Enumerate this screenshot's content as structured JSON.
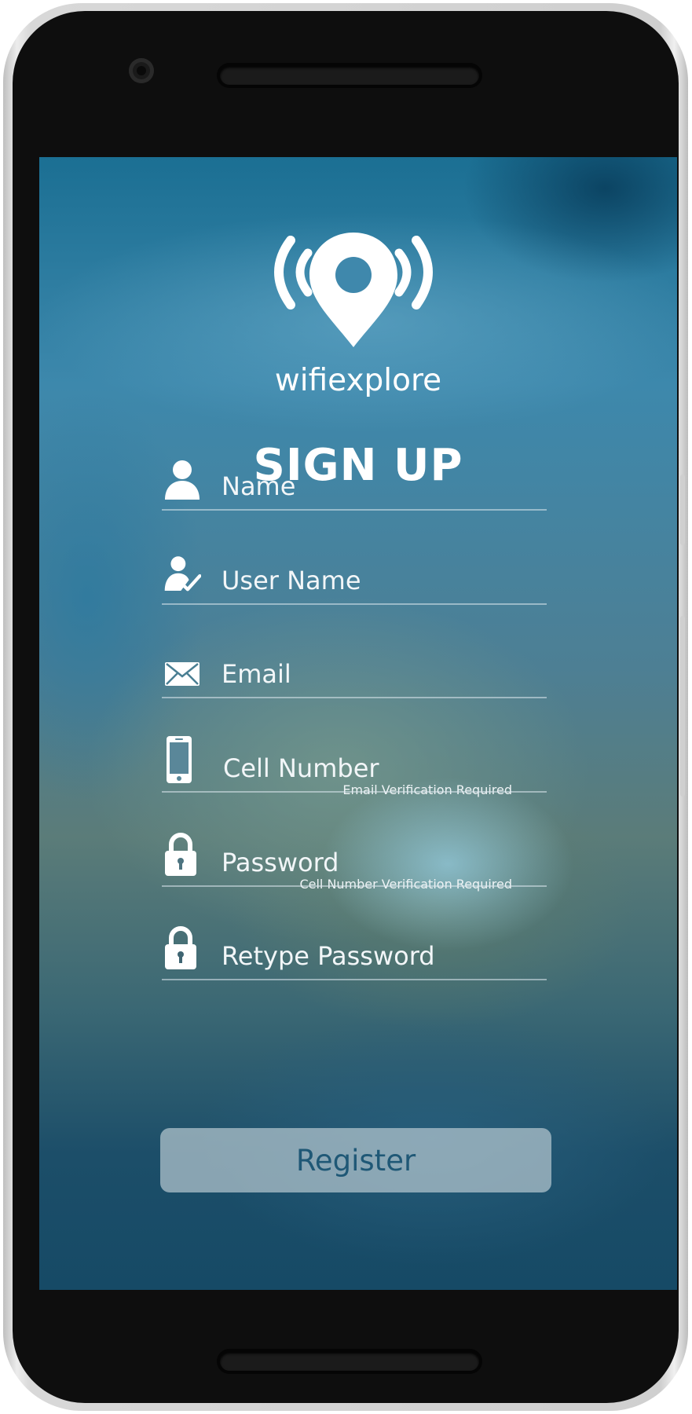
{
  "app": {
    "brand_name": "wifiexplore",
    "screen_title": "SIGN UP"
  },
  "form": {
    "fields": [
      {
        "label": "Name",
        "icon": "person-icon"
      },
      {
        "label": "User Name",
        "icon": "person-check-icon"
      },
      {
        "label": "Email",
        "icon": "envelope-icon",
        "hint": "Email Verification Required"
      },
      {
        "label": "Cell Number",
        "icon": "phone-icon",
        "hint": "Cell Number Verification Required"
      },
      {
        "label": "Password",
        "icon": "lock-icon"
      },
      {
        "label": "Retype Password",
        "icon": "lock-icon"
      }
    ],
    "submit_label": "Register"
  },
  "colors": {
    "background_primary": "#1b6f93",
    "text": "#ffffff",
    "button_text": "#1f5876",
    "button_fill": "#b4c6ce"
  }
}
